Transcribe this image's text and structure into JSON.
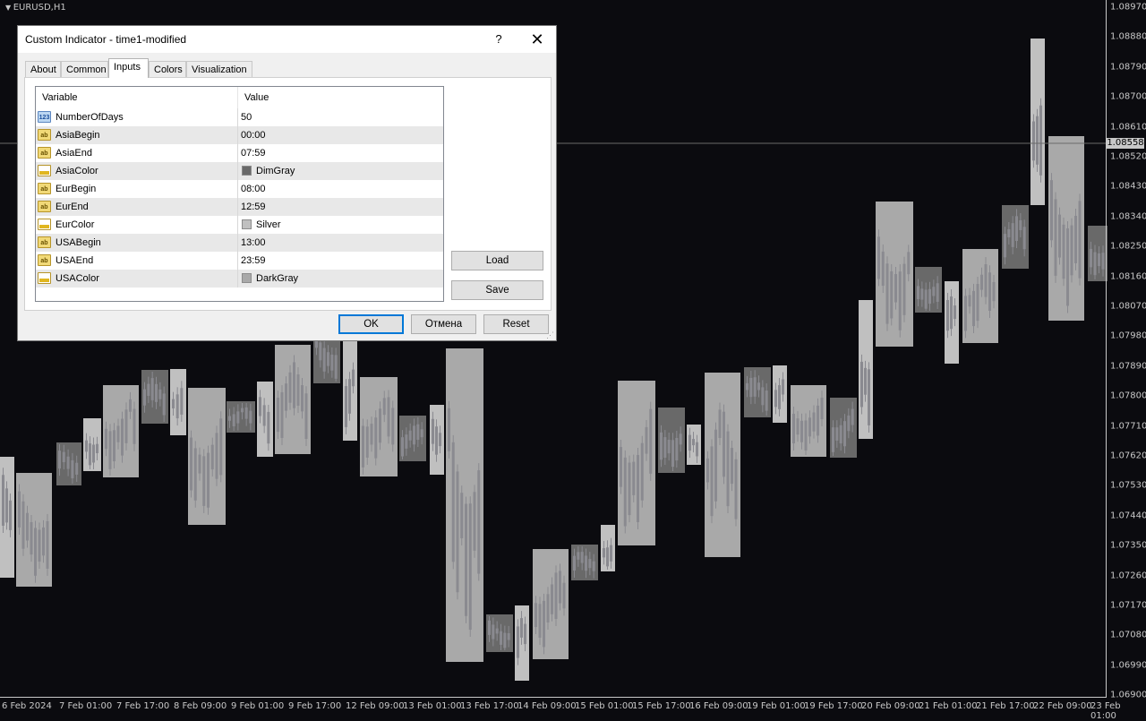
{
  "chart": {
    "symbol_title": "EURUSD,H1",
    "price_labels": [
      "1.08970",
      "1.08880",
      "1.08790",
      "1.08700",
      "1.08610",
      "1.08520",
      "1.08430",
      "1.08340",
      "1.08250",
      "1.08160",
      "1.08070",
      "1.07980",
      "1.07890",
      "1.07800",
      "1.07710",
      "1.07620",
      "1.07530",
      "1.07440",
      "1.07350",
      "1.07260",
      "1.07170",
      "1.07080",
      "1.06990",
      "1.06900"
    ],
    "current_price": "1.08558",
    "time_labels": [
      "6 Feb 2024",
      "7 Feb 01:00",
      "7 Feb 17:00",
      "8 Feb 09:00",
      "9 Feb 01:00",
      "9 Feb 17:00",
      "12 Feb 09:00",
      "13 Feb 01:00",
      "13 Feb 17:00",
      "14 Feb 09:00",
      "15 Feb 01:00",
      "15 Feb 17:00",
      "16 Feb 09:00",
      "19 Feb 01:00",
      "19 Feb 17:00",
      "20 Feb 09:00",
      "21 Feb 01:00",
      "21 Feb 17:00",
      "22 Feb 09:00",
      "23 Feb 01:00"
    ],
    "colors": {
      "background": "#0b0b0f",
      "asia": "#696969",
      "eur": "#c0c0c0",
      "usa": "#a9a9a9",
      "candle": "#8a8a90"
    }
  },
  "dialog": {
    "title": "Custom Indicator - time1-modified",
    "help_label": "?",
    "close_label": "✕",
    "tabs": [
      {
        "label": "About"
      },
      {
        "label": "Common"
      },
      {
        "label": "Inputs"
      },
      {
        "label": "Colors"
      },
      {
        "label": "Visualization"
      }
    ],
    "active_tab": "Inputs",
    "grid": {
      "col_variable": "Variable",
      "col_value": "Value",
      "rows": [
        {
          "name": "NumberOfDays",
          "type": "number",
          "value": "50"
        },
        {
          "name": "AsiaBegin",
          "type": "string",
          "value": "00:00"
        },
        {
          "name": "AsiaEnd",
          "type": "string",
          "value": "07:59"
        },
        {
          "name": "AsiaColor",
          "type": "color",
          "value": "DimGray",
          "color": "#696969"
        },
        {
          "name": "EurBegin",
          "type": "string",
          "value": "08:00"
        },
        {
          "name": "EurEnd",
          "type": "string",
          "value": "12:59"
        },
        {
          "name": "EurColor",
          "type": "color",
          "value": "Silver",
          "color": "#c0c0c0"
        },
        {
          "name": "USABegin",
          "type": "string",
          "value": "13:00"
        },
        {
          "name": "USAEnd",
          "type": "string",
          "value": "23:59"
        },
        {
          "name": "USAColor",
          "type": "color",
          "value": "DarkGray",
          "color": "#a9a9a9"
        }
      ],
      "icons": {
        "number": "123",
        "string": "ab"
      }
    },
    "buttons": {
      "load": "Load",
      "save": "Save",
      "ok": "OK",
      "cancel": "Отмена",
      "reset": "Reset"
    }
  }
}
